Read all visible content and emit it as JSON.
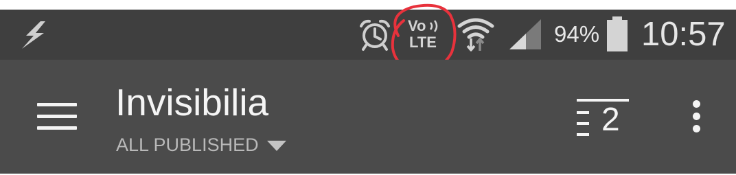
{
  "status_bar": {
    "volte_label": "Vo",
    "lte_label": "LTE",
    "battery_percent": "94%",
    "battery_level": 0.94,
    "time": "10:57",
    "icons": [
      "flash-icon",
      "alarm-icon",
      "volte-icon",
      "wifi-icon",
      "signal-icon",
      "battery-icon"
    ]
  },
  "app_bar": {
    "title": "Invisibilia",
    "subtitle": "ALL PUBLISHED",
    "sort_count": "2",
    "icons": [
      "menu-icon",
      "sort-icon",
      "more-vert-icon",
      "dropdown-caret-icon"
    ]
  },
  "annotation": {
    "color": "#e8323c"
  },
  "colors": {
    "status_bar_bg": "#3f3f3f",
    "app_bar_bg": "#4b4b4b"
  }
}
